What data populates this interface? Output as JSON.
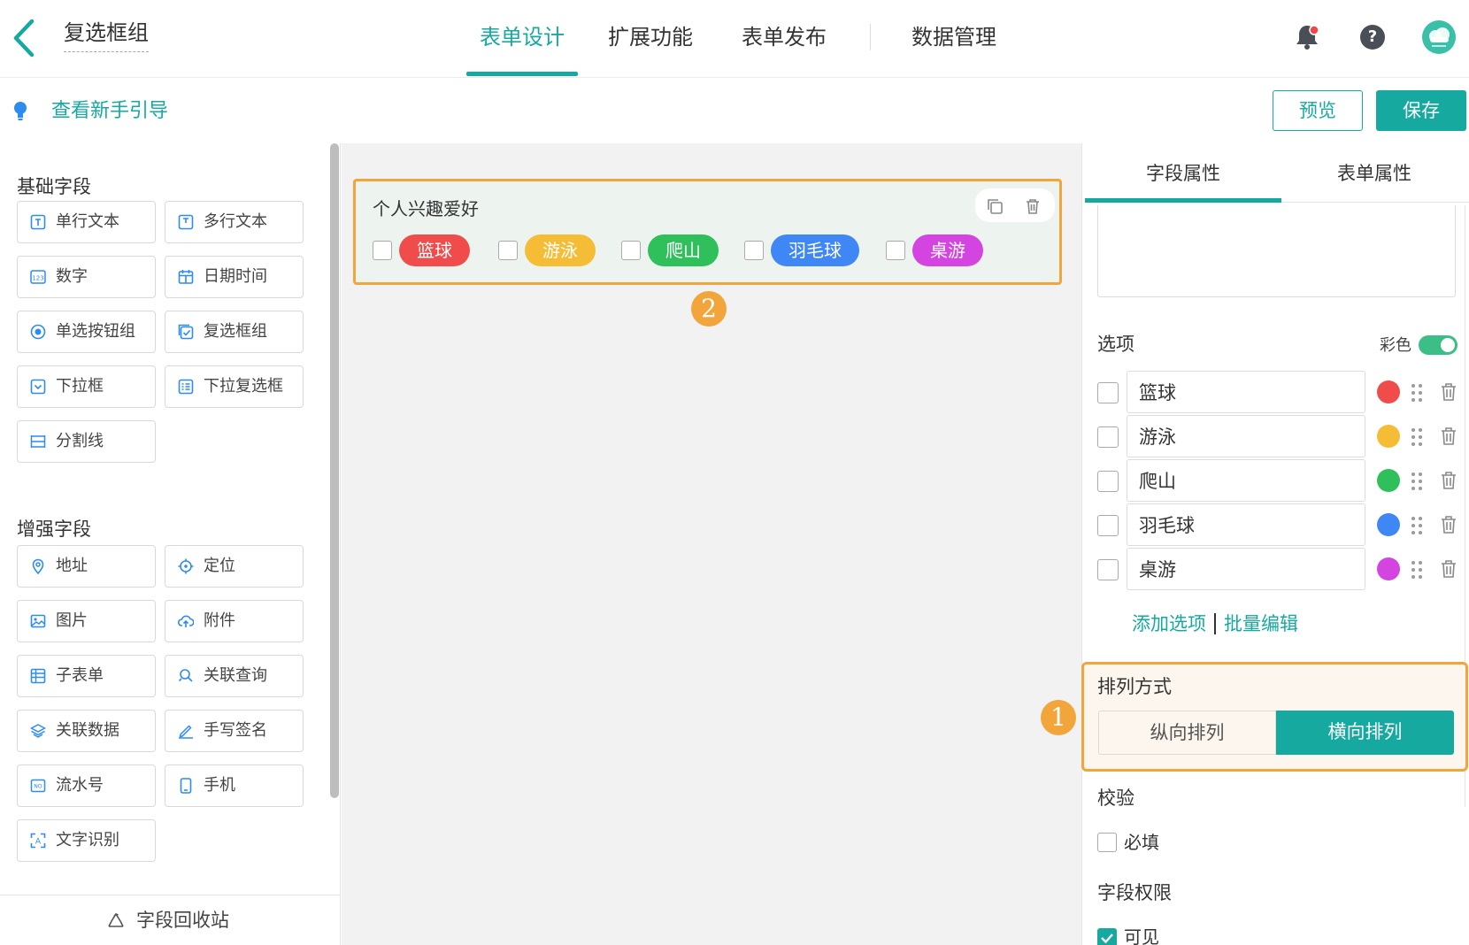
{
  "header": {
    "form_title": "复选框组",
    "tabs": [
      {
        "label": "表单设计",
        "active": true
      },
      {
        "label": "扩展功能",
        "active": false
      },
      {
        "label": "表单发布",
        "active": false
      },
      {
        "label": "数据管理",
        "active": false
      }
    ],
    "icons": [
      "back-arrow",
      "bell-with-red-dot",
      "question-circle",
      "avatar"
    ],
    "accent_color": "#16a9a0"
  },
  "subbar": {
    "guide_link": "查看新手引导",
    "preview_label": "预览",
    "save_label": "保存"
  },
  "left_panel": {
    "basic_title": "基础字段",
    "basic_fields": [
      "单行文本",
      "多行文本",
      "数字",
      "日期时间",
      "单选按钮组",
      "复选框组",
      "下拉框",
      "下拉复选框",
      "分割线"
    ],
    "enhanced_title": "增强字段",
    "enhanced_fields": [
      "地址",
      "定位",
      "图片",
      "附件",
      "子表单",
      "关联查询",
      "关联数据",
      "手写签名",
      "流水号",
      "手机",
      "文字识别"
    ],
    "recycle_label": "字段回收站"
  },
  "canvas": {
    "field_label": "个人兴趣爱好",
    "options": [
      {
        "label": "篮球",
        "color": "#f04c4c"
      },
      {
        "label": "游泳",
        "color": "#f5bd36"
      },
      {
        "label": "爬山",
        "color": "#2fc05c"
      },
      {
        "label": "羽毛球",
        "color": "#3f87f5"
      },
      {
        "label": "桌游",
        "color": "#d444e0"
      }
    ],
    "badge_2": "2"
  },
  "right_panel": {
    "tabs": [
      "字段属性",
      "表单属性"
    ],
    "options_title": "选项",
    "color_label": "彩色",
    "color_enabled": true,
    "options": [
      {
        "value": "篮球",
        "color": "#f04c4c"
      },
      {
        "value": "游泳",
        "color": "#f5bd36"
      },
      {
        "value": "爬山",
        "color": "#2fc05c"
      },
      {
        "value": "羽毛球",
        "color": "#3f87f5"
      },
      {
        "value": "桌游",
        "color": "#d444e0"
      }
    ],
    "add_option": "添加选项",
    "batch_edit": "批量编辑",
    "arrange_title": "排列方式",
    "arrange_vertical": "纵向排列",
    "arrange_horizontal": "横向排列",
    "arrange_selected": "横向排列",
    "badge_1": "1",
    "validation_title": "校验",
    "required_label": "必填",
    "required_checked": false,
    "permission_title": "字段权限",
    "visible_label": "可见",
    "visible_checked": true
  },
  "highlight_color": "#f2a53b"
}
